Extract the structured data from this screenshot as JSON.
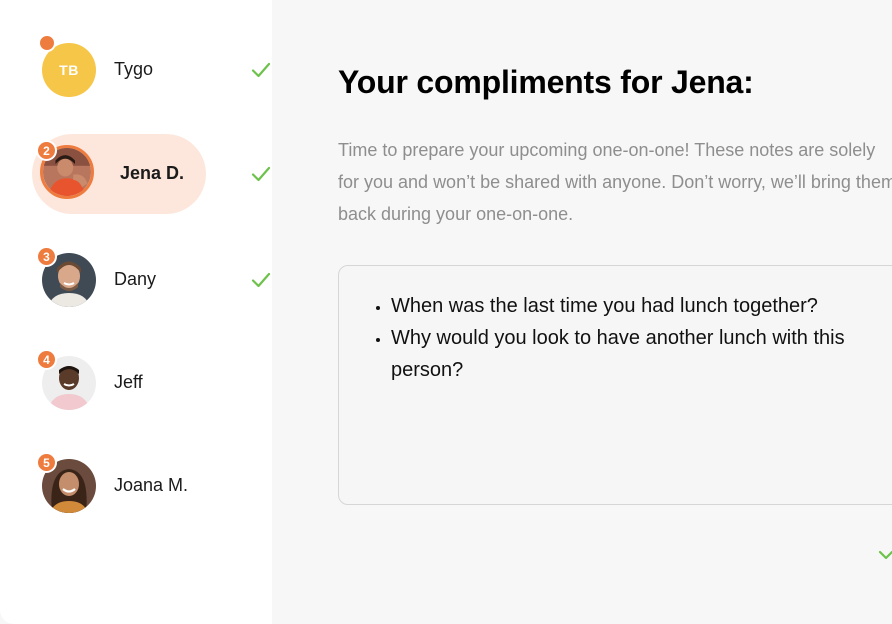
{
  "sidebar": {
    "items": [
      {
        "initials": "TB",
        "name": "Tygo",
        "badge": "",
        "done": true,
        "active": false,
        "avatar_color": "#f6c648"
      },
      {
        "initials": "",
        "name": "Jena D.",
        "badge": "2",
        "done": true,
        "active": true
      },
      {
        "initials": "",
        "name": "Dany",
        "badge": "3",
        "done": true,
        "active": false
      },
      {
        "initials": "",
        "name": "Jeff",
        "badge": "4",
        "done": false,
        "active": false
      },
      {
        "initials": "",
        "name": "Joana M.",
        "badge": "5",
        "done": false,
        "active": false
      }
    ]
  },
  "main": {
    "title": "Your compliments for Jena:",
    "description": "Time to prepare your upcoming one-on-one! These notes are solely for you and won’t be shared with anyone. Don’t worry, we’ll bring them back during your one-on-one.",
    "notes": [
      "When was the last time you had lunch together?",
      "Why would you look to have another lunch with this person?"
    ]
  },
  "colors": {
    "accent": "#ee7c3f",
    "active_bg": "#fde7dc",
    "check": "#6cc24a",
    "initials_avatar": "#f6c648"
  }
}
